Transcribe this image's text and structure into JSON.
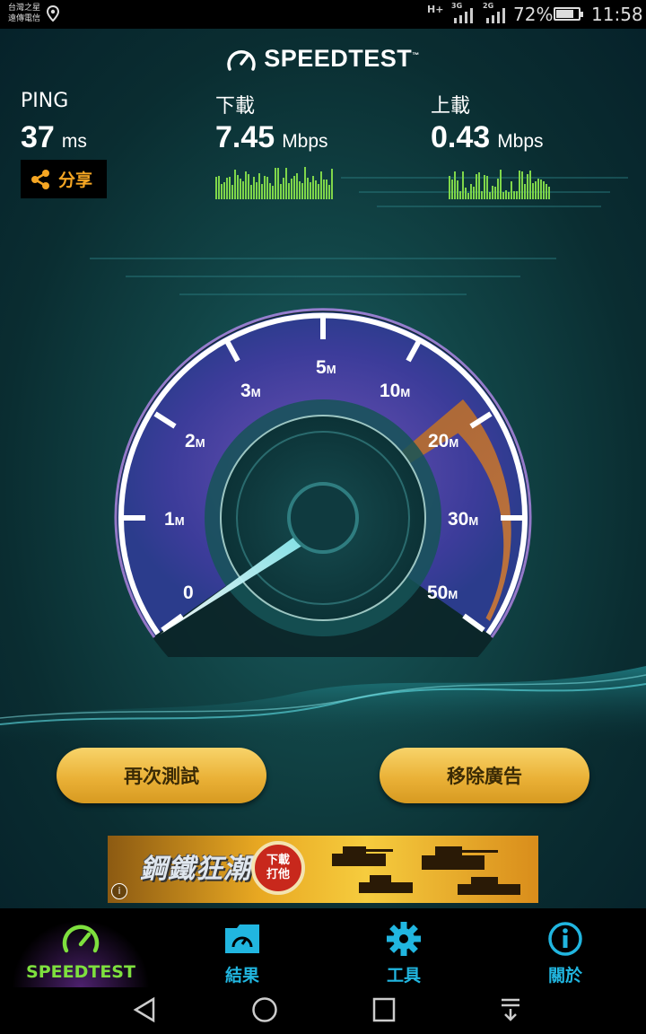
{
  "status_bar": {
    "carrier_line1": "台灣之星",
    "carrier_line2": "遠傳電信",
    "net1": "H+",
    "net2": "3G",
    "net3": "2G",
    "battery": "72%",
    "time": "11:58"
  },
  "header": {
    "logo": "SPEEDTEST",
    "trademark": "™"
  },
  "results": {
    "ping": {
      "label": "PING",
      "value": "37",
      "unit": "ms"
    },
    "download": {
      "label": "下載",
      "value": "7.45",
      "unit": "Mbps"
    },
    "upload": {
      "label": "上載",
      "value": "0.43",
      "unit": "Mbps"
    },
    "share_label": "分享"
  },
  "gauge": {
    "scale_labels": [
      {
        "num": "0",
        "unit": ""
      },
      {
        "num": "1",
        "unit": "M"
      },
      {
        "num": "2",
        "unit": "M"
      },
      {
        "num": "3",
        "unit": "M"
      },
      {
        "num": "5",
        "unit": "M"
      },
      {
        "num": "10",
        "unit": "M"
      },
      {
        "num": "20",
        "unit": "M"
      },
      {
        "num": "30",
        "unit": "M"
      },
      {
        "num": "50",
        "unit": "M"
      }
    ]
  },
  "actions": {
    "retest": "再次測試",
    "remove_ads": "移除廣告"
  },
  "ad": {
    "title": "鋼鐵狂潮",
    "badge_line1": "下載",
    "badge_line2": "打他",
    "info": "i"
  },
  "tabs": [
    {
      "label": "SPEEDTEST",
      "icon": "speedometer-icon",
      "active": true
    },
    {
      "label": "結果",
      "icon": "results-folder-icon",
      "active": false
    },
    {
      "label": "工具",
      "icon": "gear-icon",
      "active": false
    },
    {
      "label": "關於",
      "icon": "info-icon",
      "active": false
    }
  ],
  "colors": {
    "accent_green": "#7ee03e",
    "accent_blue": "#21b6e0",
    "button_gold": "#eab137",
    "share_orange": "#f5a623"
  }
}
